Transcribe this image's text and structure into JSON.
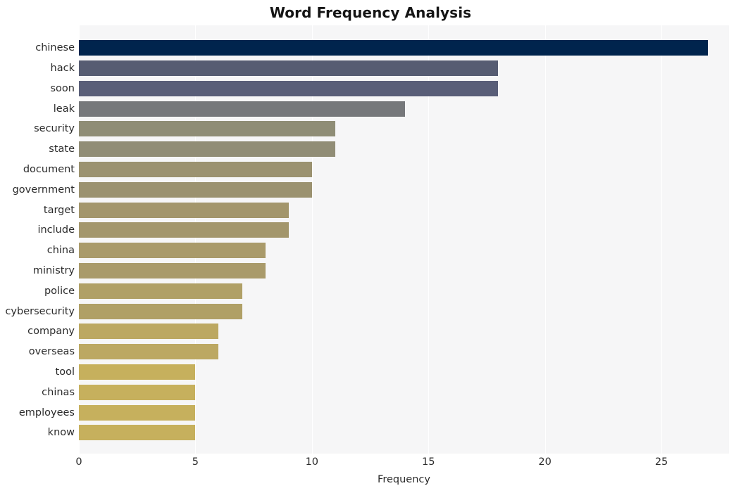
{
  "chart_data": {
    "type": "bar",
    "orientation": "horizontal",
    "title": "Word Frequency Analysis",
    "xlabel": "Frequency",
    "ylabel": "",
    "categories": [
      "chinese",
      "hack",
      "soon",
      "leak",
      "security",
      "state",
      "document",
      "government",
      "target",
      "include",
      "china",
      "ministry",
      "police",
      "cybersecurity",
      "company",
      "overseas",
      "tool",
      "chinas",
      "employees",
      "know"
    ],
    "values": [
      27,
      18,
      18,
      14,
      11,
      11,
      10,
      10,
      9,
      9,
      8,
      8,
      7,
      7,
      6,
      6,
      5,
      5,
      5,
      5
    ],
    "bar_colors": [
      "#00244d",
      "#565c72",
      "#595e78",
      "#76787b",
      "#8f8d76",
      "#918d76",
      "#9b9270",
      "#9b9270",
      "#a3966c",
      "#a3966c",
      "#a99a6a",
      "#a99a6a",
      "#b0a066",
      "#b0a066",
      "#bca862",
      "#bca862",
      "#c6b05d",
      "#c6b05d",
      "#c6b05d",
      "#c6b05d"
    ],
    "xticks": [
      0,
      5,
      10,
      15,
      20,
      25
    ],
    "xtick_labels": [
      "0",
      "5",
      "10",
      "15",
      "20",
      "25"
    ],
    "xlim": [
      0,
      27.9
    ],
    "ylim_categories": 20,
    "grid": true,
    "grid_axis": "x",
    "grid_color": "#ffffff",
    "plot_background": "#f6f6f7",
    "figure_background": "#ffffff",
    "text_color": "#2b2b2b",
    "title_color": "#151515"
  }
}
